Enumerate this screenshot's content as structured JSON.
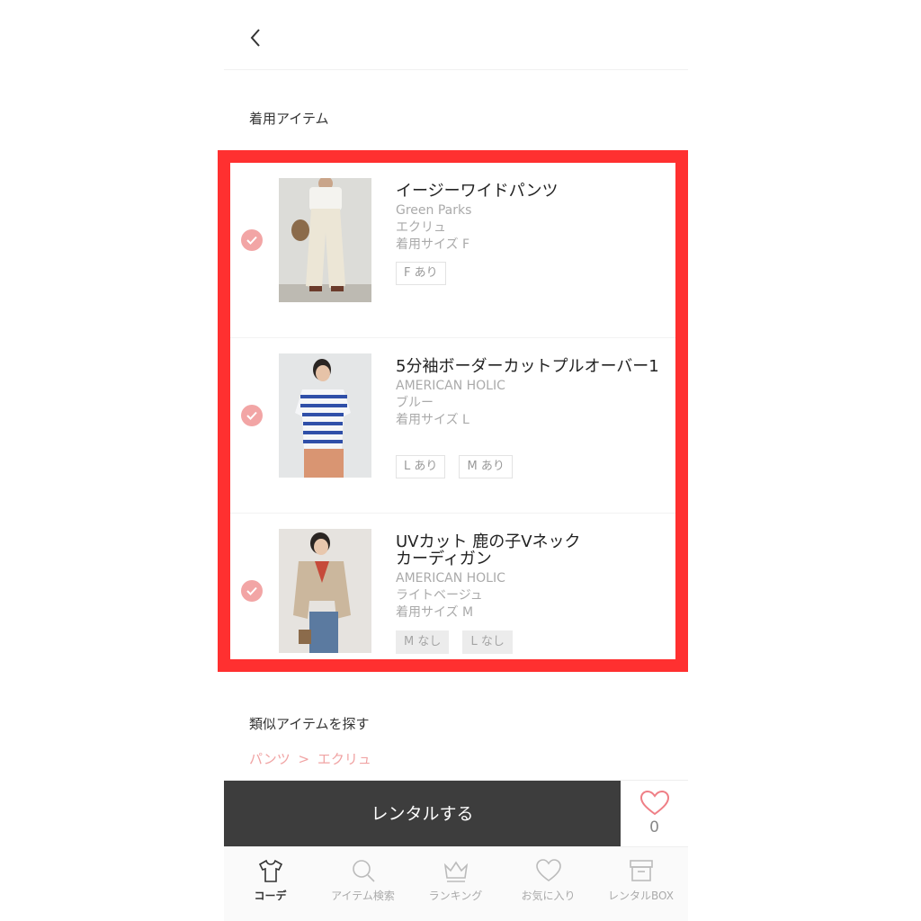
{
  "section_worn_items": "着用アイテム",
  "items": [
    {
      "name": "イージーワイドパンツ",
      "brand": "Green Parks",
      "color": "エクリュ",
      "worn_size": "着用サイズ F",
      "checked": true,
      "sizes": [
        {
          "label": "F あり",
          "available": true
        }
      ]
    },
    {
      "name": "5分袖ボーダーカットプルオーバー1",
      "brand": "AMERICAN HOLIC",
      "color": "ブルー",
      "worn_size": "着用サイズ L",
      "checked": true,
      "sizes": [
        {
          "label": "L あり",
          "available": true
        },
        {
          "label": "M あり",
          "available": true
        }
      ]
    },
    {
      "name": "UVカット 鹿の子Vネック\nカーディガン",
      "brand": "AMERICAN HOLIC",
      "color": "ライトベージュ",
      "worn_size": "着用サイズ M",
      "checked": true,
      "sizes": [
        {
          "label": "M なし",
          "available": false
        },
        {
          "label": "L なし",
          "available": false
        }
      ]
    }
  ],
  "section_similar": "類似アイテムを探す",
  "breadcrumb": {
    "category": "パンツ",
    "separator": ">",
    "color": "エクリュ"
  },
  "action": {
    "rent_label": "レンタルする",
    "fav_count": "0"
  },
  "tabs": [
    {
      "label": "コーデ",
      "icon": "tshirt-icon",
      "active": true
    },
    {
      "label": "アイテム検索",
      "icon": "search-icon",
      "active": false
    },
    {
      "label": "ランキング",
      "icon": "crown-icon",
      "active": false
    },
    {
      "label": "お気に入り",
      "icon": "heart-icon",
      "active": false
    },
    {
      "label": "レンタルBOX",
      "icon": "box-icon",
      "active": false
    }
  ],
  "colors": {
    "accent_pink": "#f2a5a5",
    "highlight_red": "#ff3030",
    "button_dark": "#3d3d3d"
  }
}
